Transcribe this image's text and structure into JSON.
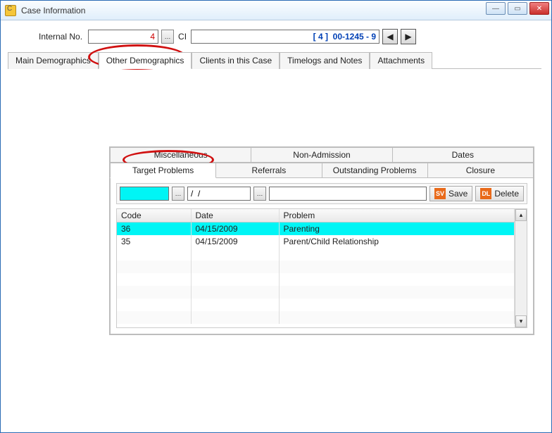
{
  "window": {
    "title": "Case Information"
  },
  "header": {
    "internal_label": "Internal No.",
    "internal_value": "4",
    "ci_label": "CI",
    "case_number": "[ 4 ]  00-1245 - 9"
  },
  "tabs": {
    "main": [
      "Main Demographics",
      "Other Demographics",
      "Clients in this Case",
      "Timelogs and Notes",
      "Attachments"
    ],
    "active_main": 1,
    "sub_top": [
      "Miscellaneous",
      "Non-Admission",
      "Dates"
    ],
    "sub_bottom": [
      "Target Problems",
      "Referrals",
      "Outstanding Problems",
      "Closure"
    ],
    "active_sub": "Target Problems"
  },
  "inputs": {
    "code_value": "",
    "date_value": "/  /",
    "desc_value": ""
  },
  "buttons": {
    "save": "Save",
    "delete": "Delete"
  },
  "table": {
    "headers": [
      "Code",
      "Date",
      "Problem"
    ],
    "rows": [
      {
        "code": "36",
        "date": "04/15/2009",
        "problem": "Parenting",
        "highlight": true
      },
      {
        "code": "35",
        "date": "04/15/2009",
        "problem": "Parent/Child Relationship",
        "highlight": false
      }
    ]
  }
}
